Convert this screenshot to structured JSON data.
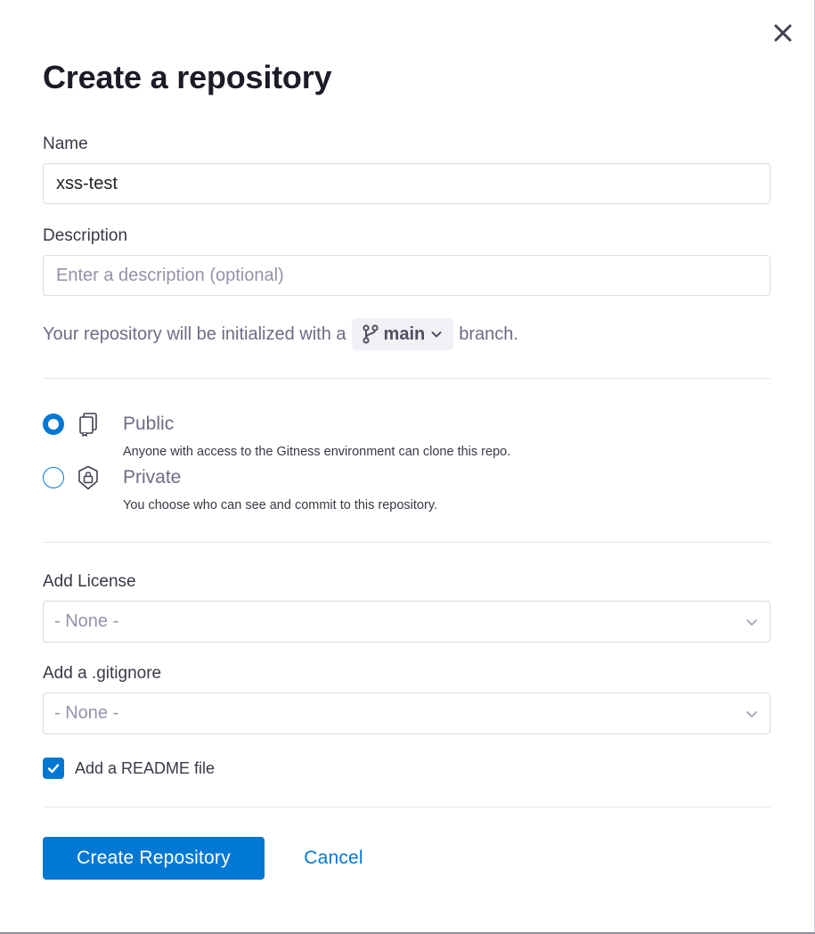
{
  "dialog": {
    "title": "Create a repository",
    "close_icon": "close-icon"
  },
  "name_field": {
    "label": "Name",
    "value": "xss-test"
  },
  "description_field": {
    "label": "Description",
    "value": "",
    "placeholder": "Enter a description (optional)"
  },
  "branch": {
    "prefix_text": "Your repository will be initialized with a",
    "branch_name": "main",
    "suffix_text": "branch.",
    "icon": "git-branch-icon"
  },
  "visibility": {
    "selected": "public",
    "options": [
      {
        "id": "public",
        "title": "Public",
        "description": "Anyone with access to the Gitness environment can clone this repo.",
        "icon": "repository-icon"
      },
      {
        "id": "private",
        "title": "Private",
        "description": "You choose who can see and commit to this repository.",
        "icon": "shield-lock-icon"
      }
    ]
  },
  "license": {
    "label": "Add License",
    "selected": "- None -"
  },
  "gitignore": {
    "label": "Add a .gitignore",
    "selected": "- None -"
  },
  "readme": {
    "label": "Add a README file",
    "checked": true
  },
  "actions": {
    "create_label": "Create Repository",
    "cancel_label": "Cancel"
  },
  "colors": {
    "primary": "#0278d5",
    "border": "#d9dae5",
    "muted_text": "#6b6d85",
    "placeholder": "#9293ab"
  }
}
